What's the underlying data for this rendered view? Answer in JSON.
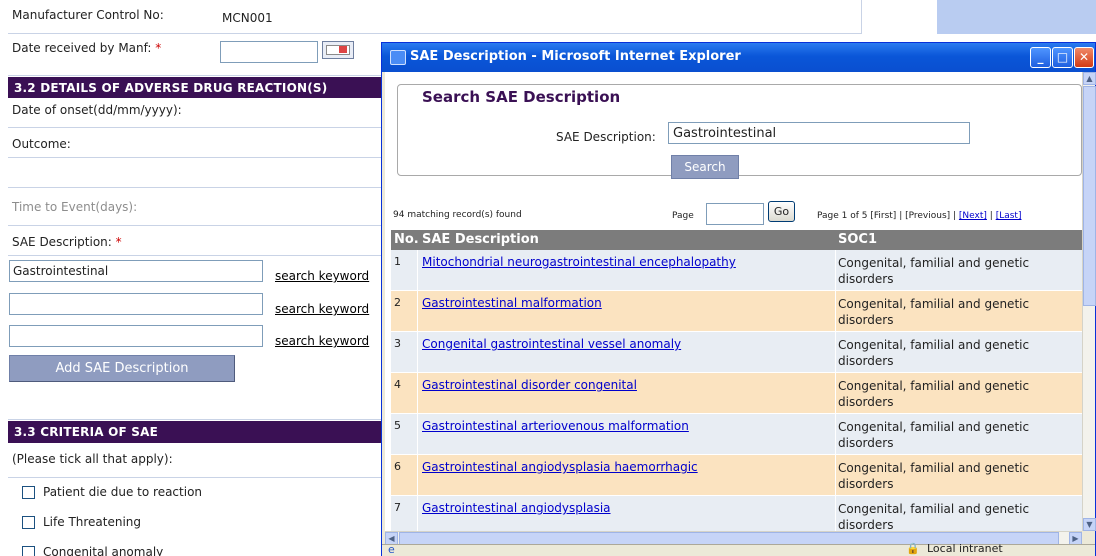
{
  "form": {
    "manufacturer_label": "Manufacturer Control No:",
    "manufacturer_value": "MCN001",
    "date_received_label": "Date received by Manf:",
    "required_mark": "*",
    "section_32": "3.2 DETAILS OF ADVERSE DRUG REACTION(S)",
    "date_onset_label": "Date of onset(dd/mm/yyyy):",
    "outcome_label": "Outcome:",
    "time_to_event_label": "Time to Event(days):",
    "sae_desc_label": "SAE Description:",
    "sae_inputs": [
      "Gastrointestinal",
      "",
      ""
    ],
    "search_keyword": "search keyword",
    "add_btn": "Add SAE Description",
    "section_33": "3.3 CRITERIA OF SAE",
    "tick_hint": "(Please tick all that apply):",
    "criteria": [
      "Patient die due to reaction",
      "Life Threatening",
      "Congenital anomaly"
    ]
  },
  "popup": {
    "title": "SAE Description - Microsoft Internet Explorer",
    "legend": "Search SAE Description",
    "search_label": "SAE Description:",
    "search_value": "Gastrointestinal",
    "search_btn": "Search",
    "found": "94 matching record(s) found",
    "page_label": "Page",
    "go_btn": "Go",
    "page_info_prefix": "Page  1  of 5 ",
    "first": "[First]",
    "previous": "[Previous]",
    "next": "[Next]",
    "last": "[Last]",
    "headers": {
      "no": "No.",
      "desc": "SAE Description",
      "soc": "SOC1"
    },
    "rows": [
      {
        "no": "1",
        "desc": "Mitochondrial neurogastrointestinal encephalopathy",
        "soc": "Congenital, familial and genetic disorders"
      },
      {
        "no": "2",
        "desc": "Gastrointestinal malformation",
        "soc": "Congenital, familial and genetic disorders"
      },
      {
        "no": "3",
        "desc": "Congenital gastrointestinal vessel anomaly",
        "soc": "Congenital, familial and genetic disorders"
      },
      {
        "no": "4",
        "desc": "Gastrointestinal disorder congenital",
        "soc": "Congenital, familial and genetic disorders"
      },
      {
        "no": "5",
        "desc": "Gastrointestinal arteriovenous malformation",
        "soc": "Congenital, familial and genetic disorders"
      },
      {
        "no": "6",
        "desc": "Gastrointestinal angiodysplasia haemorrhagic",
        "soc": "Congenital, familial and genetic disorders"
      },
      {
        "no": "7",
        "desc": "Gastrointestinal angiodysplasia",
        "soc": "Congenital, familial and genetic disorders"
      }
    ],
    "status_zone": "Local intranet"
  },
  "icons": {
    "calendar": "calendar-icon",
    "ie": "ie-icon",
    "lock": "lock-icon",
    "globe": "intranet-icon"
  },
  "colors": {
    "section_header": "#3a1054",
    "row_odd": "#e8edf3",
    "row_even": "#fbe3c0",
    "button": "#8f9cc0",
    "titlebar": "#0a56d8"
  }
}
